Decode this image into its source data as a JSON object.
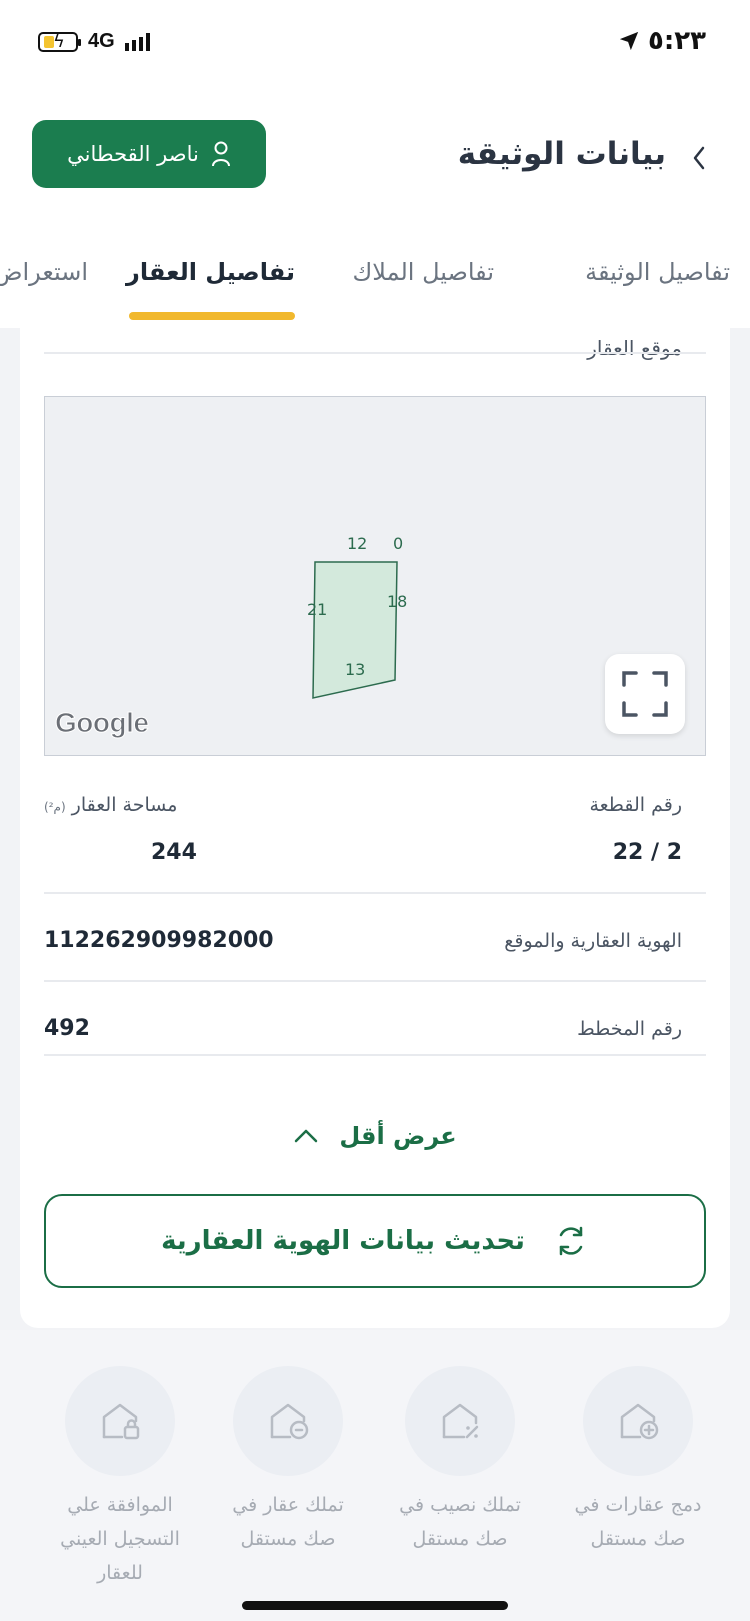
{
  "status_bar": {
    "network": "4G",
    "time": "٥:٢٣"
  },
  "header": {
    "title": "بيانات الوثيقة",
    "user_name": "ناصر القحطاني"
  },
  "tabs": [
    {
      "label": "تفاصيل الوثيقة"
    },
    {
      "label": "تفاصيل الملاك"
    },
    {
      "label": "تفاصيل العقار",
      "active": true
    },
    {
      "label": "استعراض"
    }
  ],
  "location": {
    "section_title": "موقع العقار",
    "map": {
      "attribution": "Google",
      "labels": [
        "12",
        "0",
        "21",
        "18",
        "13"
      ]
    }
  },
  "details": {
    "plot_number_label": "رقم القطعة",
    "plot_number_value": "22 / 2",
    "area_label": "مساحة العقار",
    "area_unit": "(م²)",
    "area_value": "244",
    "real_estate_id_label": "الهوية العقارية والموقع",
    "real_estate_id_value": "112262909982000",
    "plan_number_label": "رقم المخطط",
    "plan_number_value": "492"
  },
  "show_less_label": "عرض أقل",
  "refresh_button_label": "تحديث بيانات الهوية العقارية",
  "actions": [
    {
      "label_line1": "دمج عقارات في",
      "label_line2": "صك مستقل"
    },
    {
      "label_line1": "تملك نصيب في",
      "label_line2": "صك مستقل"
    },
    {
      "label_line1": "تملك عقار في",
      "label_line2": "صك مستقل"
    },
    {
      "label_line1": "الموافقة علي",
      "label_line2": "التسجيل العيني",
      "label_line3": "للعقار"
    }
  ],
  "colors": {
    "brand_green": "#1b7d4f",
    "tab_indicator": "#f1b82d",
    "parcel_fill": "#cfe8d9",
    "parcel_stroke": "#2c6b4e"
  }
}
